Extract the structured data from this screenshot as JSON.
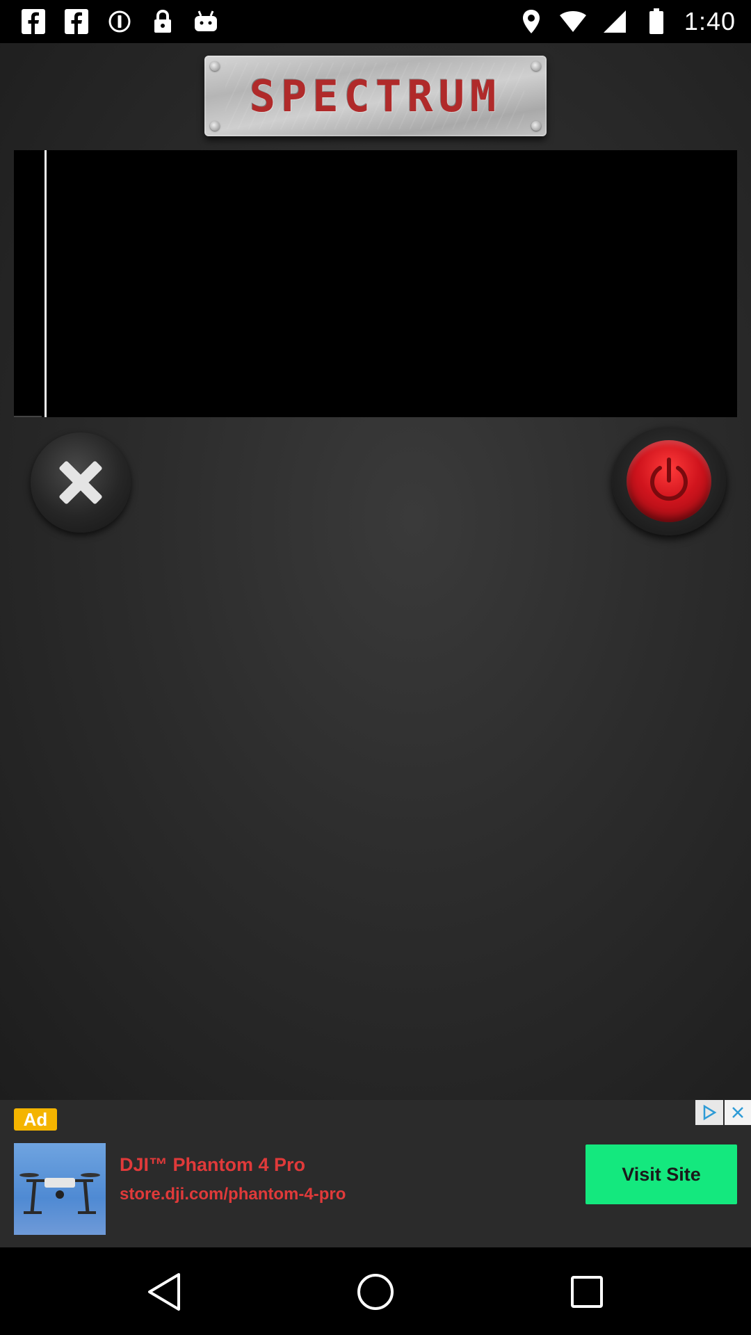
{
  "status_bar": {
    "time": "1:40",
    "left_icons": [
      "facebook-icon",
      "facebook-icon",
      "circle-info-icon",
      "lock-icon",
      "android-icon"
    ],
    "right_icons": [
      "location-pin-icon",
      "wifi-signal-icon",
      "cell-signal-icon",
      "battery-icon"
    ]
  },
  "app": {
    "title": "SPECTRUM",
    "title_color": "#b02a2a",
    "power_color": "#d0141d"
  },
  "ad": {
    "badge": "Ad",
    "title": "DJI™ Phantom 4 Pro",
    "url": "store.dji.com/phantom-4-pro",
    "cta": "Visit Site",
    "cta_color": "#14e87e",
    "text_color": "#e03a3a"
  },
  "nav": {
    "icons": [
      "back-icon",
      "home-icon",
      "recents-icon"
    ]
  }
}
